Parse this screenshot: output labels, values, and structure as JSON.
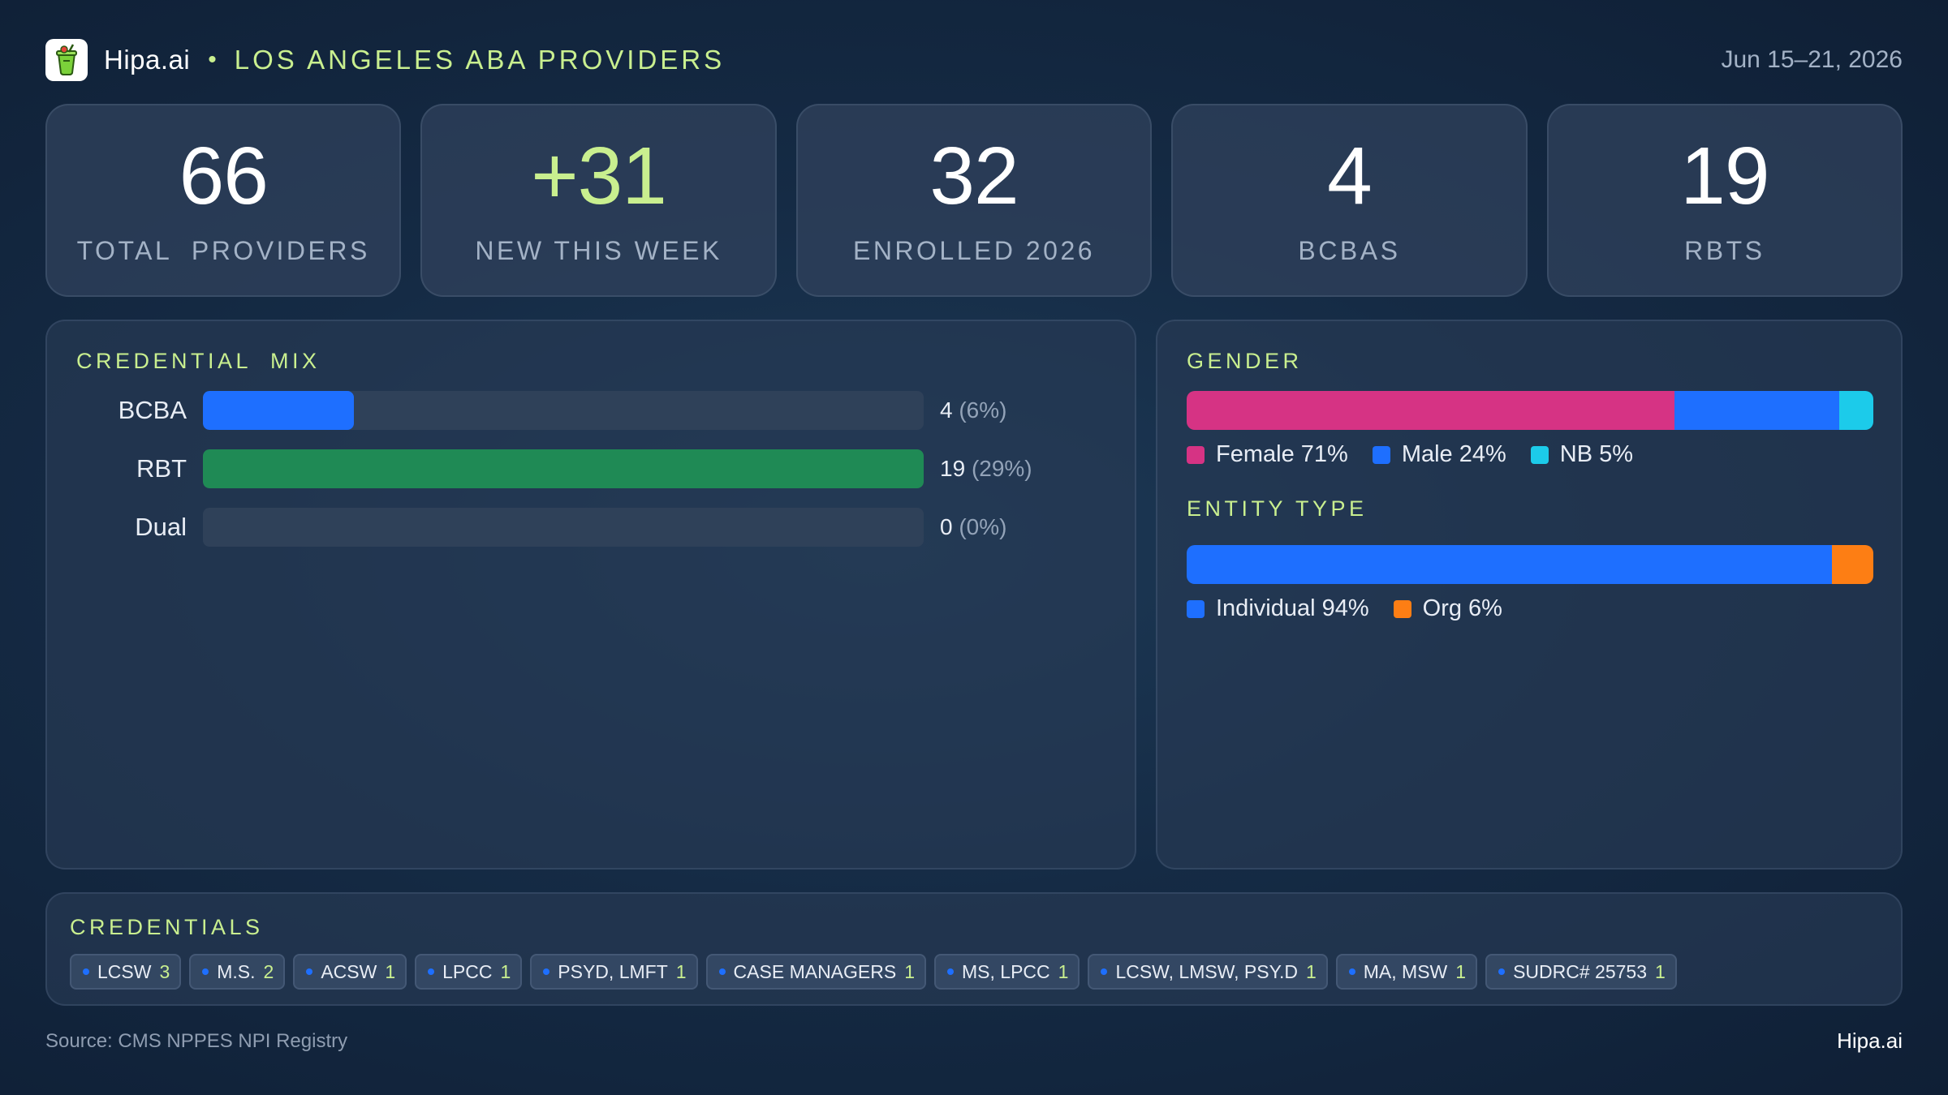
{
  "header": {
    "brand": "Hipa.ai",
    "separator": "•",
    "subtitle": "LOS ANGELES ABA PROVIDERS",
    "date_range": "Jun 15–21, 2026",
    "logo_icon": "cup-icon"
  },
  "stats": [
    {
      "value": "66",
      "label": "TOTAL  PROVIDERS"
    },
    {
      "value": "+31",
      "label": "NEW THIS WEEK"
    },
    {
      "value": "32",
      "label": "ENROLLED 2026"
    },
    {
      "value": "4",
      "label": "BCBAS"
    },
    {
      "value": "19",
      "label": "RBTS"
    }
  ],
  "credential_mix": {
    "title": "CREDENTIAL  MIX",
    "rows": [
      {
        "label": "BCBA",
        "count": "4",
        "pct": "(6%)",
        "fill": 0.21,
        "color": "#1e6fff"
      },
      {
        "label": "RBT",
        "count": "19",
        "pct": "(29%)",
        "fill": 1.0,
        "color": "#1f8a55"
      },
      {
        "label": "Dual",
        "count": "0",
        "pct": "(0%)",
        "fill": 0.0,
        "color": "#1e6fff"
      }
    ]
  },
  "gender": {
    "title": "GENDER",
    "segments": [
      {
        "label": "Female 71%",
        "share": 0.71,
        "color": "#d63384"
      },
      {
        "label": "Male 24%",
        "share": 0.24,
        "color": "#1e6fff"
      },
      {
        "label": "NB 5%",
        "share": 0.05,
        "color": "#1ccbea"
      }
    ]
  },
  "entity_type": {
    "title": "ENTITY TYPE",
    "segments": [
      {
        "label": "Individual 94%",
        "share": 0.94,
        "color": "#1e6fff"
      },
      {
        "label": "Org 6%",
        "share": 0.06,
        "color": "#fd7e14"
      }
    ]
  },
  "credentials": {
    "title": "CREDENTIALS",
    "chips": [
      {
        "name": "LCSW",
        "count": "3"
      },
      {
        "name": "M.S.",
        "count": "2"
      },
      {
        "name": "ACSW",
        "count": "1"
      },
      {
        "name": "LPCC",
        "count": "1"
      },
      {
        "name": "PSYD, LMFT",
        "count": "1"
      },
      {
        "name": "CASE MANAGERS",
        "count": "1"
      },
      {
        "name": "MS, LPCC",
        "count": "1"
      },
      {
        "name": "LCSW, LMSW, PSY.D",
        "count": "1"
      },
      {
        "name": "MA, MSW",
        "count": "1"
      },
      {
        "name": "SUDRC# 25753",
        "count": "1"
      }
    ]
  },
  "footer": {
    "source": "Source: CMS NPPES NPI Registry",
    "brand": "Hipa.ai"
  },
  "colors": {
    "accent": "#c9ef8f",
    "blue": "#1e6fff",
    "green": "#1f8a55",
    "pink": "#d63384",
    "cyan": "#1ccbea",
    "orange": "#fd7e14"
  }
}
